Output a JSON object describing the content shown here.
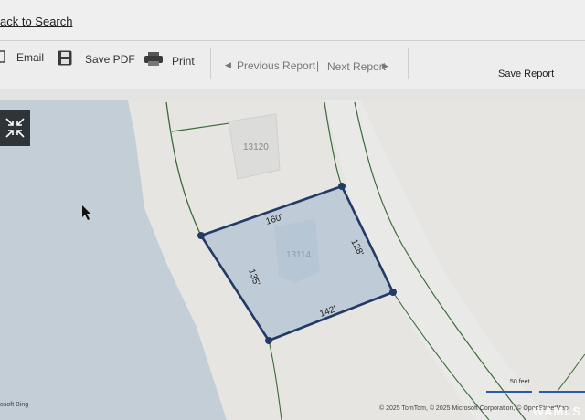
{
  "nav": {
    "back_label": "ack to Search"
  },
  "toolbar": {
    "email_label": "Email",
    "save_pdf_label": "Save PDF",
    "print_label": "Print",
    "previous_label": "Previous Report",
    "separator": "|",
    "next_label": "Next Report",
    "save_report_label": "Save Report"
  },
  "map": {
    "parcel_north_label": "13120",
    "parcel_main_label": "13114",
    "edge_top": "160'",
    "edge_right": "128'",
    "edge_left": "135'",
    "edge_bottom": "142'",
    "scale_label": "50 feet",
    "attribution": "© 2025 TomTom, © 2025 Microsoft Corporation, © OpenStreetMap",
    "bing_label": "osoft Bing",
    "watermark": "WAMLS"
  },
  "colors": {
    "parcel_stroke": "#233a66",
    "parcel_fill": "#b8c7d6",
    "water": "#c3ced6",
    "boundary_line": "#3c6a3a"
  },
  "icons": {
    "email": "email-icon",
    "save_pdf": "save-icon",
    "print": "printer-icon",
    "fullscreen": "fullscreen-icon"
  }
}
